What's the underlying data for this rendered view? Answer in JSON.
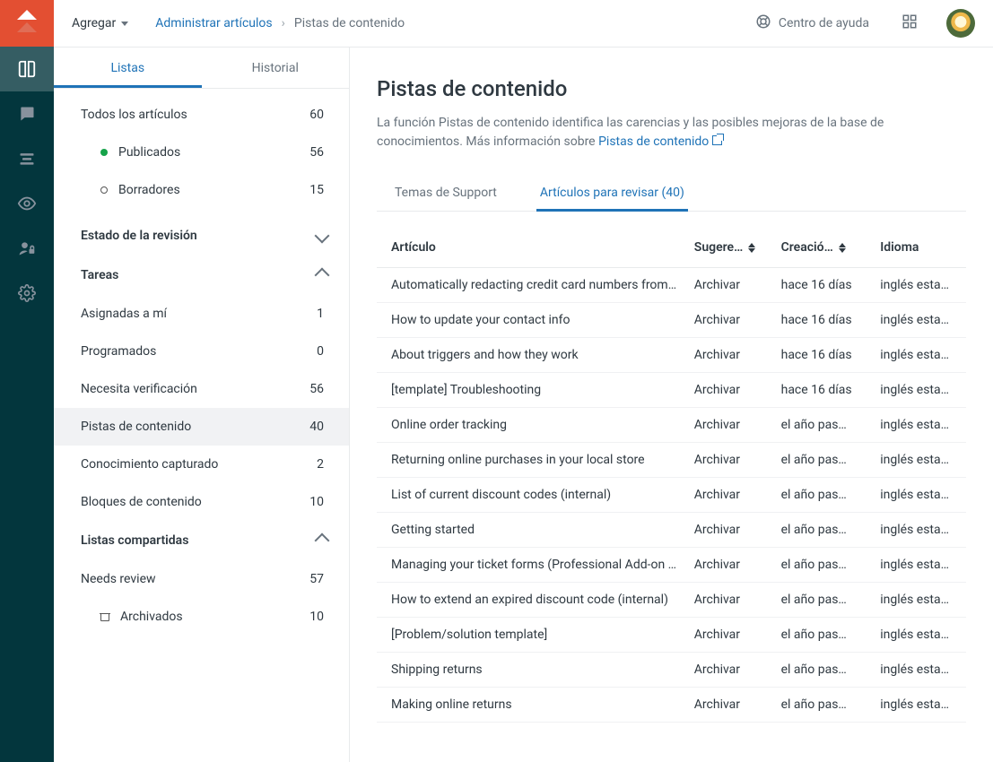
{
  "topbar": {
    "add_label": "Agregar",
    "breadcrumb_root": "Administrar artículos",
    "breadcrumb_current": "Pistas de contenido",
    "help_label": "Centro de ayuda"
  },
  "side": {
    "tab_lists": "Listas",
    "tab_history": "Historial",
    "all_label": "Todos los artículos",
    "all_count": "60",
    "published_label": "Publicados",
    "published_count": "56",
    "drafts_label": "Borradores",
    "drafts_count": "15",
    "review_state_header": "Estado de la revisión",
    "tasks_header": "Tareas",
    "assigned_label": "Asignadas a mí",
    "assigned_count": "1",
    "scheduled_label": "Programados",
    "scheduled_count": "0",
    "verify_label": "Necesita verificación",
    "verify_count": "56",
    "cues_label": "Pistas de contenido",
    "cues_count": "40",
    "captured_label": "Conocimiento capturado",
    "captured_count": "2",
    "blocks_label": "Bloques de contenido",
    "blocks_count": "10",
    "shared_header": "Listas compartidas",
    "needs_review_label": "Needs review",
    "needs_review_count": "57",
    "archived_label": "Archivados",
    "archived_count": "10"
  },
  "content": {
    "title": "Pistas de contenido",
    "desc_line": "La función Pistas de contenido identifica las carencias y las posibles mejoras de la base de conocimientos. Más información sobre ",
    "desc_link": "Pistas de contenido",
    "tab_support": "Temas de Support",
    "tab_review": "Artículos para revisar (40)",
    "columns": {
      "article": "Artículo",
      "suggestion": "Sugere…",
      "created": "Creació…",
      "language": "Idioma"
    },
    "rows": [
      {
        "article": "Automatically redacting credit card numbers from…",
        "suggestion": "Archivar",
        "created": "hace 16 días",
        "language": "inglés esta…"
      },
      {
        "article": "How to update your contact info",
        "suggestion": "Archivar",
        "created": "hace 16 días",
        "language": "inglés esta…"
      },
      {
        "article": "About triggers and how they work",
        "suggestion": "Archivar",
        "created": "hace 16 días",
        "language": "inglés esta…"
      },
      {
        "article": "[template] Troubleshooting",
        "suggestion": "Archivar",
        "created": "hace 16 días",
        "language": "inglés esta…"
      },
      {
        "article": "Online order tracking",
        "suggestion": "Archivar",
        "created": "el año pas…",
        "language": "inglés esta…"
      },
      {
        "article": "Returning online purchases in your local store",
        "suggestion": "Archivar",
        "created": "el año pas…",
        "language": "inglés esta…"
      },
      {
        "article": "List of current discount codes (internal)",
        "suggestion": "Archivar",
        "created": "el año pas…",
        "language": "inglés esta…"
      },
      {
        "article": "Getting started",
        "suggestion": "Archivar",
        "created": "el año pas…",
        "language": "inglés esta…"
      },
      {
        "article": "Managing your ticket forms (Professional Add-on …",
        "suggestion": "Archivar",
        "created": "el año pas…",
        "language": "inglés esta…"
      },
      {
        "article": "How to extend an expired discount code (internal)",
        "suggestion": "Archivar",
        "created": "el año pas…",
        "language": "inglés esta…"
      },
      {
        "article": "[Problem/solution template]",
        "suggestion": "Archivar",
        "created": "el año pas…",
        "language": "inglés esta…"
      },
      {
        "article": "Shipping returns",
        "suggestion": "Archivar",
        "created": "el año pas…",
        "language": "inglés esta…"
      },
      {
        "article": "Making online returns",
        "suggestion": "Archivar",
        "created": "el año pas…",
        "language": "inglés esta…"
      }
    ]
  }
}
